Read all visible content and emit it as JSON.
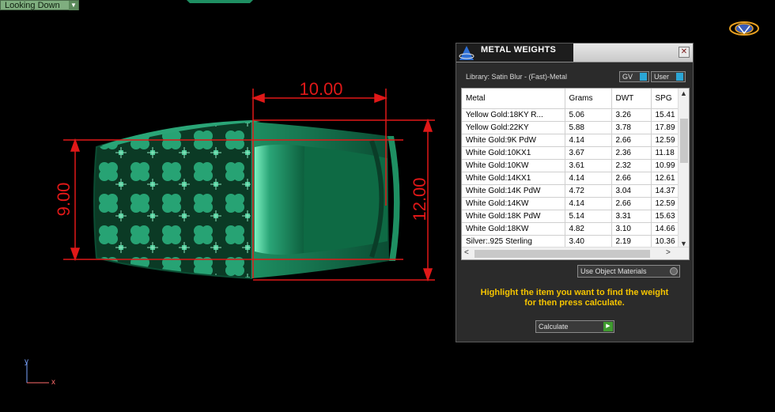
{
  "viewport": {
    "view_label": "Looking Down",
    "dimensions": [
      "10.00",
      "9.00",
      "12.00"
    ],
    "axis_y": "y",
    "axis_x": "x"
  },
  "panel": {
    "title": "METAL WEIGHTS",
    "close_glyph": "✕",
    "library": "Library: Satin Blur - (Fast)-Metal",
    "toggles": [
      "GV",
      "User"
    ],
    "columns": [
      "Metal",
      "Grams",
      "DWT",
      "SPG"
    ],
    "rows": [
      [
        "Yellow Gold:18KY R...",
        "5.06",
        "3.26",
        "15.41"
      ],
      [
        "Yellow Gold:22KY",
        "5.88",
        "3.78",
        "17.89"
      ],
      [
        "White Gold:9K PdW",
        "4.14",
        "2.66",
        "12.59"
      ],
      [
        "White Gold:10KX1",
        "3.67",
        "2.36",
        "11.18"
      ],
      [
        "White Gold:10KW",
        "3.61",
        "2.32",
        "10.99"
      ],
      [
        "White Gold:14KX1",
        "4.14",
        "2.66",
        "12.61"
      ],
      [
        "White Gold:14K PdW",
        "4.72",
        "3.04",
        "14.37"
      ],
      [
        "White Gold:14KW",
        "4.14",
        "2.66",
        "12.59"
      ],
      [
        "White Gold:18K PdW",
        "5.14",
        "3.31",
        "15.63"
      ],
      [
        "White Gold:18KW",
        "4.82",
        "3.10",
        "14.66"
      ],
      [
        "Silver:.925 Sterling",
        "3.40",
        "2.19",
        "10.36"
      ]
    ],
    "use_object_materials": "Use Object Materials",
    "hint_line1": "Highlight the item you want to find the weight",
    "hint_line2": "for then press calculate.",
    "calculate_label": "Calculate"
  },
  "colors": {
    "metal_green": "#1f9a6a",
    "dimension_red": "#e01818",
    "hint_yellow": "#f5c400"
  },
  "icons": [
    "viewport-dropdown-icon",
    "app-logo-icon",
    "panel-app-icon",
    "close-icon",
    "toggle-knob-icon",
    "play-icon"
  ]
}
